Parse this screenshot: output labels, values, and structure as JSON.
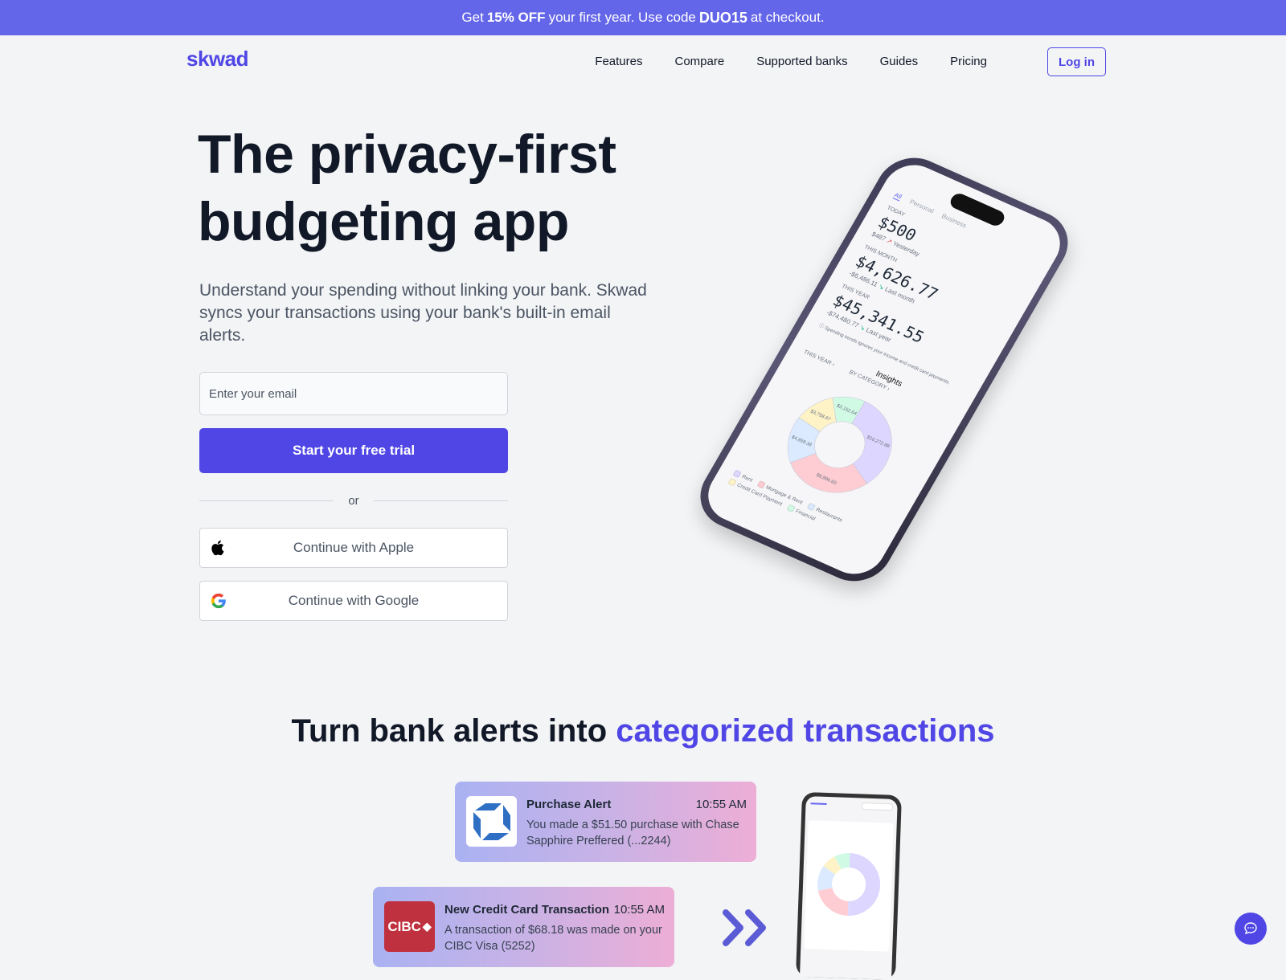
{
  "promo": {
    "prefix": "Get",
    "discount": "15% OFF",
    "middle": "your first year. Use code",
    "code": "DUO15",
    "suffix": "at checkout."
  },
  "nav": {
    "logo": "skwad",
    "links": [
      "Features",
      "Compare",
      "Supported banks",
      "Guides",
      "Pricing"
    ],
    "login": "Log in"
  },
  "hero": {
    "title_line1": "The privacy-first",
    "title_line2": "budgeting app",
    "subtitle": "Understand your spending without linking your bank. Skwad syncs your transactions using your bank's built-in email alerts.",
    "email_placeholder": "Enter your email",
    "cta": "Start your free trial",
    "divider": "or",
    "apple": "Continue with Apple",
    "google": "Continue with Google"
  },
  "phone": {
    "tabs": [
      "All",
      "Personal",
      "Business"
    ],
    "today_label": "TODAY",
    "today_value": "$500",
    "today_compare": "$487",
    "today_compare_label": "Yesterday",
    "month_label": "THIS MONTH",
    "month_value": "$4,626.77",
    "month_compare": "-$6,486.11",
    "month_compare_label": "Last month",
    "year_label": "THIS YEAR",
    "year_value": "$45,341.55",
    "year_compare": "-$74,480.77",
    "year_compare_label": "Last year",
    "note": "Spending trends ignores your income and credit card payments.",
    "insights": "Insights",
    "filter1": "THIS YEAR",
    "filter2": "BY CATEGORY",
    "donut": [
      {
        "label": "Rent",
        "value": 10272.88,
        "text": "$10,272.88",
        "color": "#ddd6fe"
      },
      {
        "label": "Mortgage & Rent",
        "value": 8896.6,
        "text": "$8,896.60",
        "color": "#fecdd3"
      },
      {
        "label": "Restaurants",
        "value": 4858.38,
        "text": "$4,858.38",
        "color": "#dbeafe"
      },
      {
        "label": "Credit Card Payment",
        "value": 3758.67,
        "text": "$3,758.67",
        "color": "#fef3c7"
      },
      {
        "label": "Financial",
        "value": 3152.64,
        "text": "$3,152.64",
        "color": "#d1fae5"
      }
    ]
  },
  "section2": {
    "heading": "Turn bank alerts into",
    "heading_accent": "categorized transactions",
    "alerts": [
      {
        "title": "Purchase Alert",
        "time": "10:55 AM",
        "body": "You made a $51.50 purchase with Chase Sapphire Preffered (...2244)",
        "bank": "Chase"
      },
      {
        "title": "New Credit Card Transaction",
        "time": "10:55 AM",
        "body": "A transaction of $68.18 was made on your CIBC Visa (5252)",
        "bank": "CIBC"
      }
    ]
  },
  "colors": {
    "brand": "#4f46e5",
    "promo_bg": "#6466e9"
  }
}
